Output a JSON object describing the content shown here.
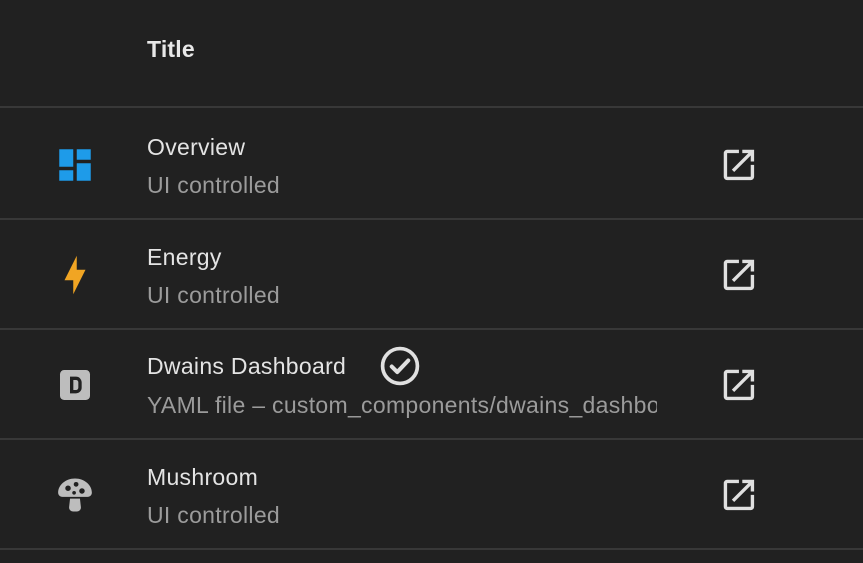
{
  "header": {
    "title": "Title"
  },
  "rows": [
    {
      "title": "Overview",
      "subtitle": "UI controlled",
      "icon": "view-dashboard-icon",
      "icon_color": "#1e9be9"
    },
    {
      "title": "Energy",
      "subtitle": "UI controlled",
      "icon": "lightning-bolt-icon",
      "icon_color": "#f1a523"
    },
    {
      "title": "Dwains Dashboard",
      "subtitle": "YAML file – custom_components/dwains_dashboard",
      "icon": "letter-d-box-icon",
      "icon_color": "#bdbdbd",
      "default": true
    },
    {
      "title": "Mushroom",
      "subtitle": "UI controlled",
      "icon": "mushroom-icon",
      "icon_color": "#bdbdbd"
    }
  ],
  "colors": {
    "background": "#212121",
    "divider": "#383838",
    "primary_text": "#e4e4e4",
    "secondary_text": "#9b9b9b"
  }
}
